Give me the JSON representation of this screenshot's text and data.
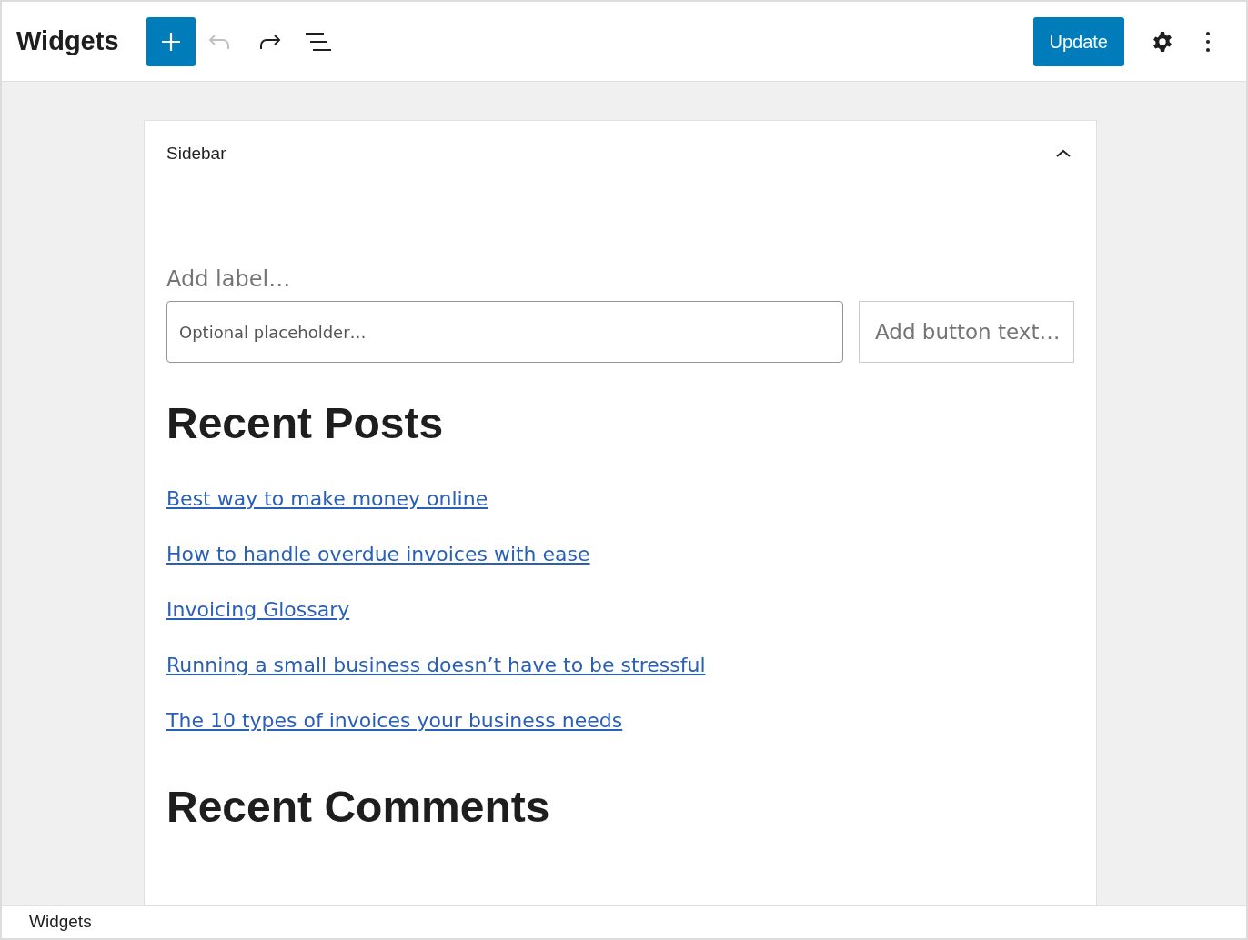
{
  "header": {
    "title": "Widgets",
    "undo_disabled": true,
    "redo_disabled": false,
    "update_button": "Update"
  },
  "sidebar_panel": {
    "title": "Sidebar",
    "expanded": true,
    "search_block": {
      "label_placeholder": "Add label…",
      "input_placeholder": "Optional placeholder…",
      "button_placeholder": "Add button text…"
    },
    "recent_posts": {
      "heading": "Recent Posts",
      "posts": [
        "Best way to make money online",
        "How to handle overdue invoices with ease",
        "Invoicing Glossary",
        "Running a small business doesn’t have to be stressful",
        "The 10 types of invoices your business needs"
      ]
    },
    "recent_comments": {
      "heading": "Recent Comments"
    }
  },
  "footer": {
    "breadcrumb": "Widgets"
  }
}
